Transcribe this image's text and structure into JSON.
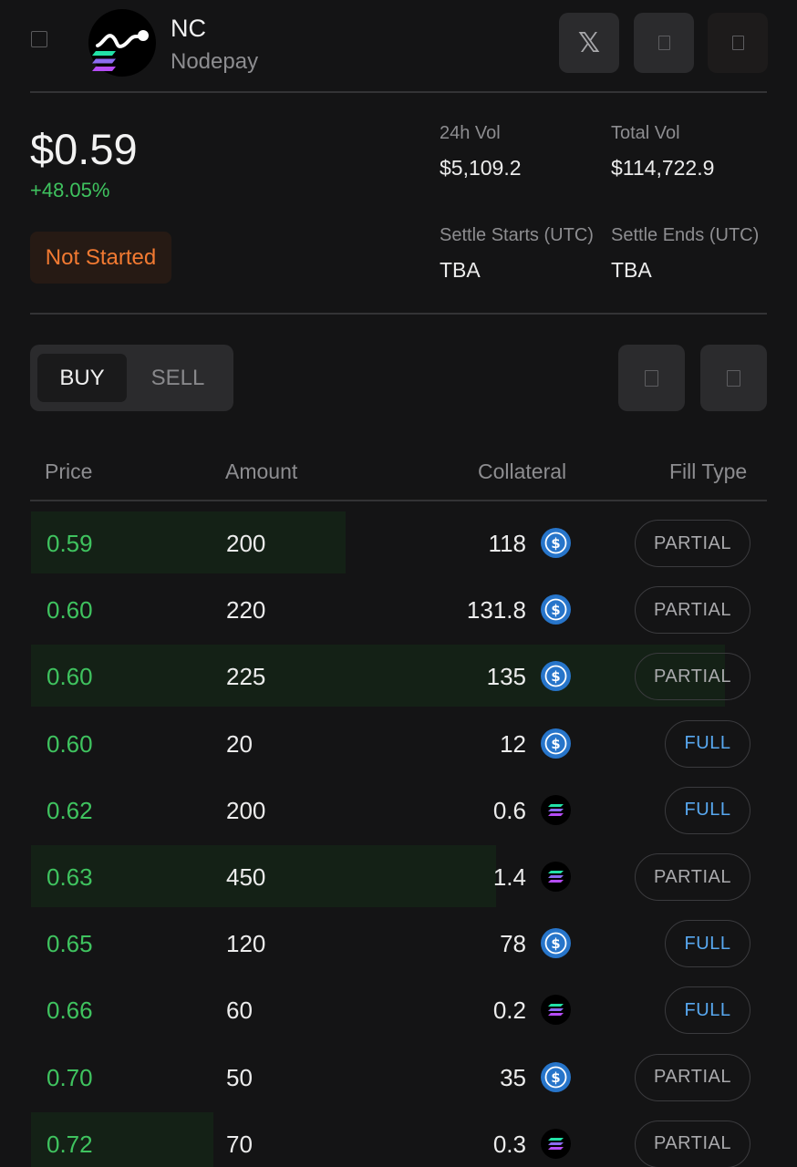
{
  "header": {
    "title": "NC",
    "subtitle": "Nodepay",
    "x_glyph": "𝕏",
    "icons": [
      "back-icon",
      "x-twitter-icon",
      "share-icon",
      "more-icon"
    ]
  },
  "market": {
    "price": "$0.59",
    "change": "+48.05%",
    "status": "Not Started",
    "vol24_label": "24h Vol",
    "vol24_value": "$5,109.2",
    "totalvol_label": "Total Vol",
    "totalvol_value": "$114,722.9",
    "settle_start_label": "Settle Starts (UTC)",
    "settle_start_value": "TBA",
    "settle_end_label": "Settle Ends (UTC)",
    "settle_end_value": "TBA"
  },
  "colors": {
    "positive": "#3fc35f",
    "status_orange": "#f27a32",
    "full_blue": "#58a8f0",
    "usdc_blue": "#2775ca",
    "background": "#141415"
  },
  "tabs": {
    "buy": "BUY",
    "sell": "SELL",
    "selected": "BUY"
  },
  "table": {
    "headers": {
      "price": "Price",
      "amount": "Amount",
      "collateral": "Collateral",
      "fill_type": "Fill Type"
    },
    "rows": [
      {
        "price": "0.59",
        "amount": "200",
        "collateral": "118",
        "token": "usdc",
        "fill": "PARTIAL",
        "depth": 0.427
      },
      {
        "price": "0.60",
        "amount": "220",
        "collateral": "131.8",
        "token": "usdc",
        "fill": "PARTIAL",
        "depth": 0
      },
      {
        "price": "0.60",
        "amount": "225",
        "collateral": "135",
        "token": "usdc",
        "fill": "PARTIAL",
        "depth": 0.942
      },
      {
        "price": "0.60",
        "amount": "20",
        "collateral": "12",
        "token": "usdc",
        "fill": "FULL",
        "depth": 0
      },
      {
        "price": "0.62",
        "amount": "200",
        "collateral": "0.6",
        "token": "sol",
        "fill": "FULL",
        "depth": 0
      },
      {
        "price": "0.63",
        "amount": "450",
        "collateral": "1.4",
        "token": "sol",
        "fill": "PARTIAL",
        "depth": 0.631
      },
      {
        "price": "0.65",
        "amount": "120",
        "collateral": "78",
        "token": "usdc",
        "fill": "FULL",
        "depth": 0
      },
      {
        "price": "0.66",
        "amount": "60",
        "collateral": "0.2",
        "token": "sol",
        "fill": "FULL",
        "depth": 0
      },
      {
        "price": "0.70",
        "amount": "50",
        "collateral": "35",
        "token": "usdc",
        "fill": "PARTIAL",
        "depth": 0
      },
      {
        "price": "0.72",
        "amount": "70",
        "collateral": "0.3",
        "token": "sol",
        "fill": "PARTIAL",
        "depth": 0.248
      }
    ]
  }
}
